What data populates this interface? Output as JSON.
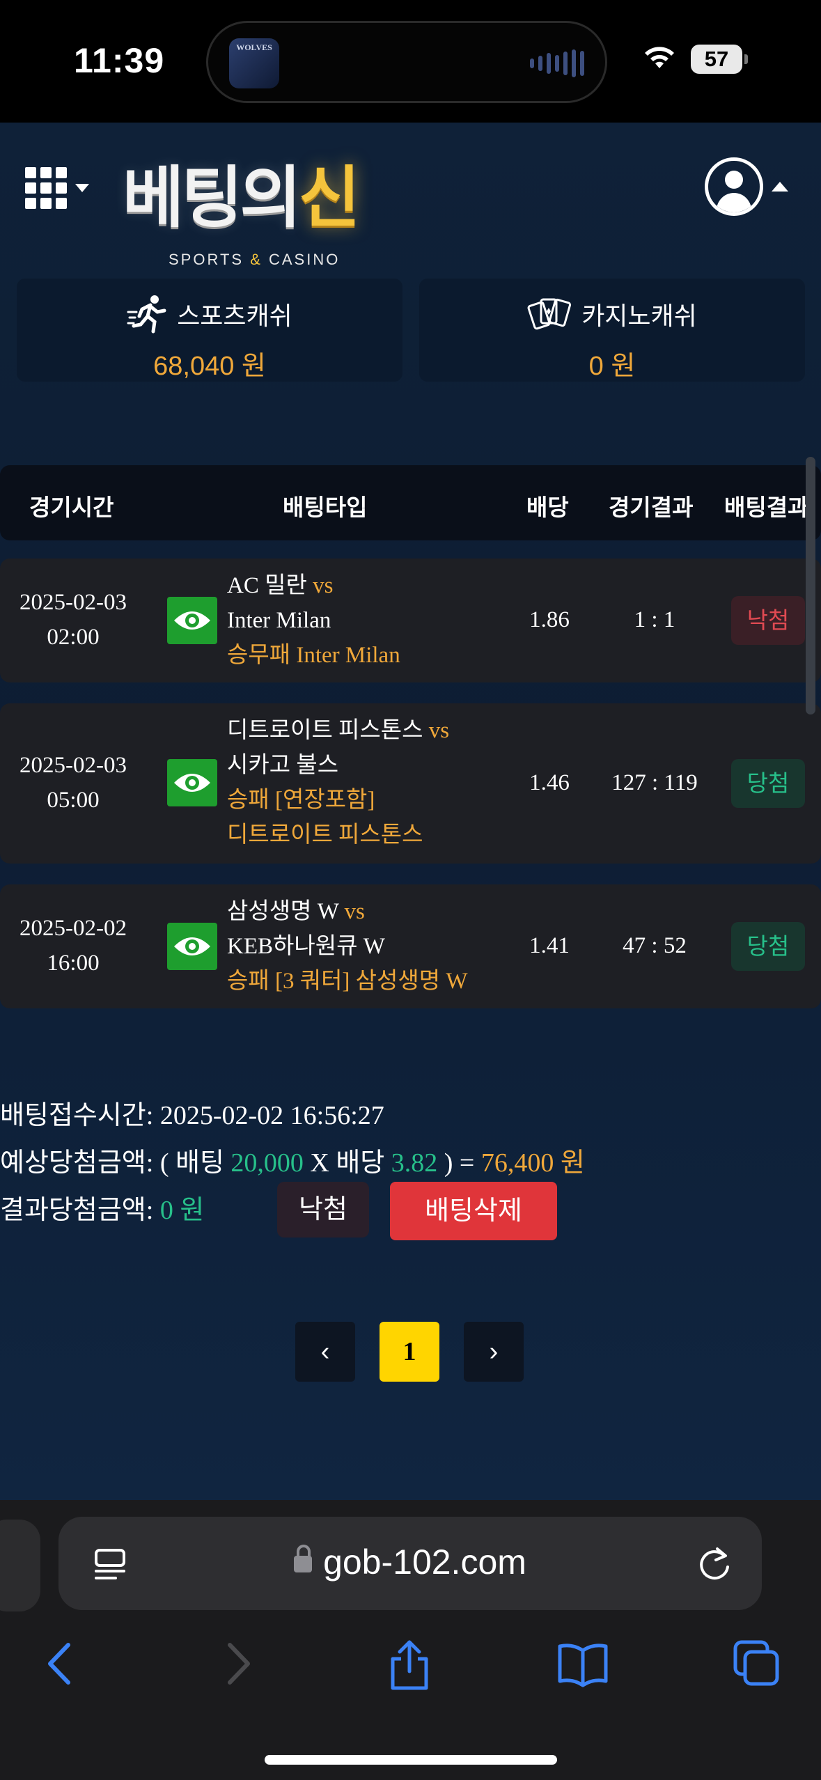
{
  "status_bar": {
    "time": "11:39",
    "battery": "57",
    "album_art_text": "WOLVES"
  },
  "header": {
    "logo_main": "베팅의",
    "logo_gold": "신",
    "logo_sub_left": "SPORTS",
    "logo_sub_amp": "&",
    "logo_sub_right": "CASINO"
  },
  "wallet": {
    "sports_label": "스포츠캐쉬",
    "sports_value": "68,040 원",
    "casino_label": "카지노캐쉬",
    "casino_value": "0 원"
  },
  "table": {
    "headers": {
      "time": "경기시간",
      "type": "배팅타입",
      "odds": "배당",
      "score": "경기결과",
      "result": "배팅결과"
    },
    "rows": [
      {
        "date": "2025-02-03",
        "time": "02:00",
        "home": "AC 밀란",
        "vs": "vs",
        "away": "Inter Milan",
        "pick1": "승무패 Inter Milan",
        "pick2": "",
        "odds": "1.86",
        "score": "1 : 1",
        "result": "낙첨"
      },
      {
        "date": "2025-02-03",
        "time": "05:00",
        "home": "디트로이트 피스톤스",
        "vs": "vs",
        "away": "시카고 불스",
        "pick1": "승패 [연장포함]",
        "pick2": "디트로이트 피스톤스",
        "odds": "1.46",
        "score": "127 : 119",
        "result": "당첨"
      },
      {
        "date": "2025-02-02",
        "time": "16:00",
        "home": "삼성생명 W",
        "vs": "vs",
        "away": "KEB하나원큐 W",
        "pick1": "승패 [3 쿼터] 삼성생명 W",
        "pick2": "",
        "odds": "1.41",
        "score": "47 : 52",
        "result": "당첨"
      }
    ]
  },
  "summary": {
    "time_label": "배팅접수시간:",
    "time_value": "2025-02-02 16:56:27",
    "expected_label": "예상당첨금액:",
    "open_paren": "( 배팅",
    "bet_amount": "20,000",
    "x_odds": "X 배당",
    "odds_value": "3.82",
    "close_eq": ") =",
    "expected_value": "76,400 원",
    "actual_label": "결과당첨금액:",
    "actual_value": "0 원",
    "status_button": "낙첨",
    "delete_button": "배팅삭제"
  },
  "pagination": {
    "prev": "‹",
    "current": "1",
    "next": "›"
  },
  "browser": {
    "url": "gob-102.com"
  },
  "colors": {
    "accent_orange": "#f0a83a",
    "win_green": "#27c08a",
    "lose_red": "#e04a52",
    "delete_red": "#e0353a",
    "page_yellow": "#ffd500"
  }
}
